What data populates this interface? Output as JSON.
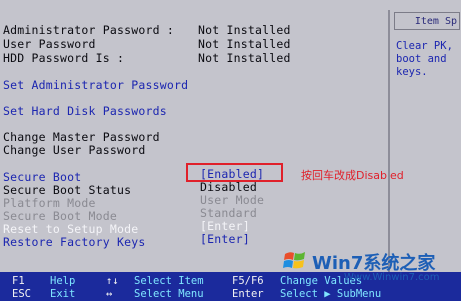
{
  "status": [
    {
      "label": "Administrator Password :",
      "value": "Not Installed"
    },
    {
      "label": "User Password",
      "value": "Not Installed"
    },
    {
      "label": "HDD Password Is :",
      "value": "Not Installed"
    }
  ],
  "menu": {
    "set_admin_password": "Set Administrator Password",
    "set_hdd_passwords": "Set Hard Disk Passwords",
    "change_master_password": "Change Master Password",
    "change_user_password": "Change User Password"
  },
  "settings": [
    {
      "label": "Secure Boot",
      "value": "[Enabled]"
    },
    {
      "label": "Secure Boot Status",
      "value": "Disabled"
    },
    {
      "label": "Platform Mode",
      "value": "User Mode"
    },
    {
      "label": "Secure Boot Mode",
      "value": "Standard"
    },
    {
      "label": "Reset to Setup Mode",
      "value": "[Enter]"
    },
    {
      "label": "Restore Factory Keys",
      "value": "[Enter]"
    }
  ],
  "help_panel": {
    "title": "Item Sp",
    "lines": [
      "Clear PK,",
      "boot and",
      "keys."
    ]
  },
  "annotation": "按回车改成Disabled",
  "footer": [
    {
      "key": "F1",
      "desc": "Help"
    },
    {
      "key": "↑↓",
      "desc": "Select Item"
    },
    {
      "key": "F5/F6",
      "desc": "Change Values"
    },
    {
      "key": "ESC",
      "desc": "Exit"
    },
    {
      "key": "↔",
      "desc": "Select Menu"
    },
    {
      "key": "Enter",
      "desc": "Select ▶ SubMenu"
    }
  ],
  "watermark": {
    "brand": "Win7系统之家",
    "url": "Www.Winwin7.com"
  },
  "colors": {
    "background": "#c4c4cc",
    "menu_blue": "#1c26b0",
    "footer_bg": "#1b2a9c",
    "callout_red": "#e0202a"
  }
}
